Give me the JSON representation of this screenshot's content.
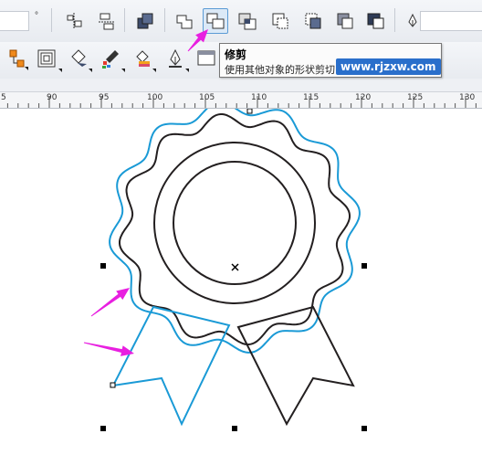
{
  "toolbar": {
    "degree_symbol": "°",
    "active_button": "trim",
    "icons": [
      "align-icon",
      "distribute-icon",
      "combine-icon",
      "weld-icon",
      "trim-icon",
      "intersect-icon",
      "simplify-icon",
      "front-minus-back-icon",
      "back-minus-front-icon",
      "boundary-icon",
      "pen-icon"
    ]
  },
  "tooltip": {
    "title": "修剪",
    "description": "使用其他对象的形状剪切"
  },
  "watermark": "www.rjzxw.com",
  "ruler": {
    "labels": [
      "5",
      "90",
      "95",
      "100",
      "105",
      "110",
      "115",
      "120",
      "125",
      "130"
    ]
  },
  "colors": {
    "selection_outline": "#1a9ad6",
    "shape_stroke": "#231f20",
    "arrow_annotation": "#e81fe0",
    "active_button_border": "#5b9bd5"
  }
}
